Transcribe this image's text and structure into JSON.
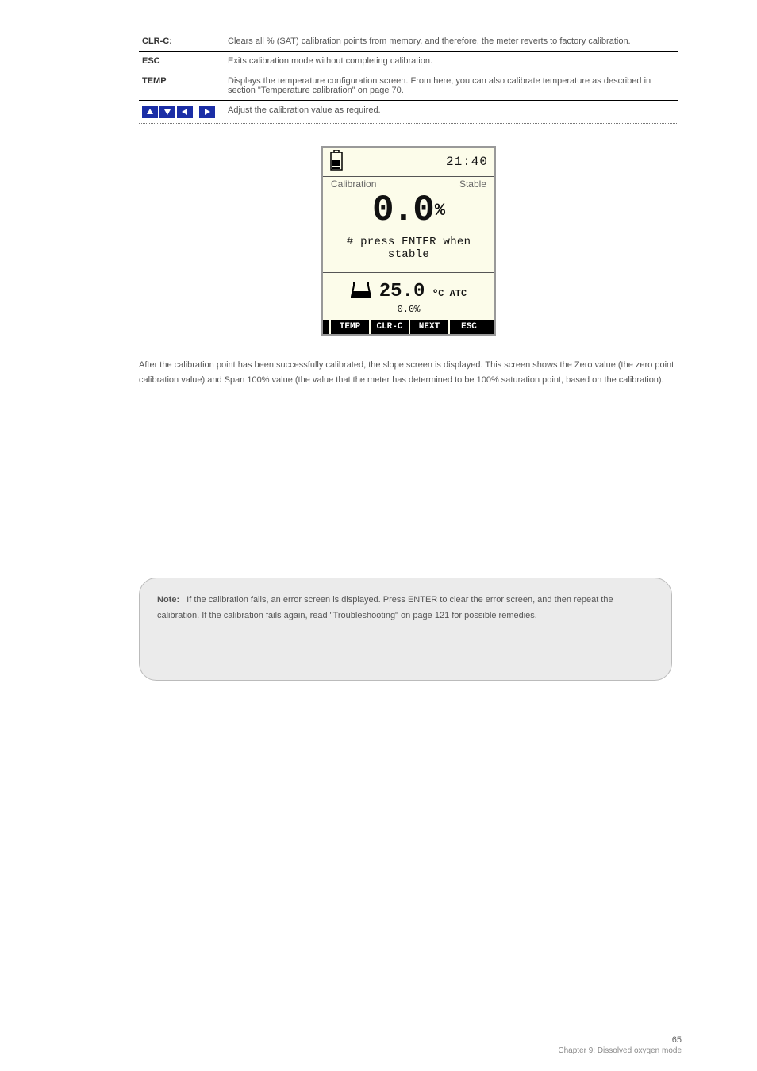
{
  "keys": {
    "clr_c": {
      "key": "CLR-C:",
      "desc": "Clears all % (SAT) calibration points from memory, and therefore, the meter reverts to factory calibration."
    },
    "esc": {
      "key": "ESC",
      "desc": "Exits calibration mode without completing calibration."
    },
    "temp": {
      "key": "TEMP",
      "desc": "Displays the temperature configuration screen. From here, you can also calibrate temperature as described in section \"Temperature calibration\" on page 70."
    },
    "arrows": {
      "desc": "Adjust the calibration value as required."
    }
  },
  "lcd": {
    "time": "21:40",
    "mode": "Calibration",
    "status": "Stable",
    "reading": "0.0",
    "reading_unit": "%",
    "prompt": "# press ENTER when stable",
    "temp_value": "25.0",
    "temp_unit": "ºC ATC",
    "cal_value": "0.0%",
    "softkeys": [
      "TEMP",
      "CLR-C",
      "NEXT",
      "ESC"
    ]
  },
  "post": "After the calibration point has been successfully calibrated, the slope screen is displayed. This screen shows the Zero value (the zero point calibration value) and Span 100% value (the value that the meter has determined to be 100% saturation point, based on the calibration).",
  "note": {
    "label": "Note:",
    "text": "If the calibration fails, an error screen is displayed. Press ENTER to clear the error screen, and then repeat the calibration. If the calibration fails again, read \"Troubleshooting\" on page 121 for possible remedies."
  },
  "footer": {
    "page": "65",
    "chapter": "Chapter 9: Dissolved oxygen mode"
  }
}
